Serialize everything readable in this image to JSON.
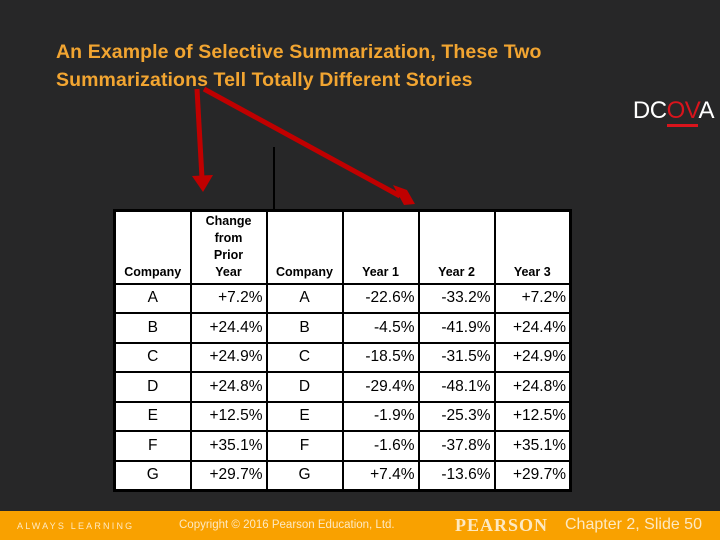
{
  "slide": {
    "title": "An Example of Selective Summarization, These Two Summarizations Tell Totally Different Stories",
    "logo": {
      "prefix": "DC",
      "highlight": "OV",
      "suffix": "A",
      "highlight_color": "#d9141c"
    },
    "colors": {
      "background": "#272728",
      "title": "#f2a531",
      "footer": "#f9a100",
      "arrow": "#c00000"
    }
  },
  "table": {
    "headers": [
      "Company",
      "Change from Prior Year",
      "Company",
      "Year 1",
      "Year 2",
      "Year 3"
    ],
    "header_lines": [
      [
        "Company"
      ],
      [
        "Change",
        "from",
        "Prior",
        "Year"
      ],
      [
        "Company"
      ],
      [
        "Year 1"
      ],
      [
        "Year 2"
      ],
      [
        "Year 3"
      ]
    ],
    "rows": [
      [
        "A",
        "+7.2%",
        "A",
        "-22.6%",
        "-33.2%",
        "+7.2%"
      ],
      [
        "B",
        "+24.4%",
        "B",
        "-4.5%",
        "-41.9%",
        "+24.4%"
      ],
      [
        "C",
        "+24.9%",
        "C",
        "-18.5%",
        "-31.5%",
        "+24.9%"
      ],
      [
        "D",
        "+24.8%",
        "D",
        "-29.4%",
        "-48.1%",
        "+24.8%"
      ],
      [
        "E",
        "+12.5%",
        "E",
        "-1.9%",
        "-25.3%",
        "+12.5%"
      ],
      [
        "F",
        "+35.1%",
        "F",
        "-1.6%",
        "-37.8%",
        "+35.1%"
      ],
      [
        "G",
        "+29.7%",
        "G",
        "+7.4%",
        "-13.6%",
        "+29.7%"
      ]
    ]
  },
  "footer": {
    "tagline": "ALWAYS LEARNING",
    "copyright": "Copyright © 2016 Pearson Education, Ltd.",
    "brand": "PEARSON",
    "slide_number": "Chapter 2, Slide 50"
  },
  "icons": [
    "arrow-down-icon",
    "arrow-diagonal-icon"
  ]
}
